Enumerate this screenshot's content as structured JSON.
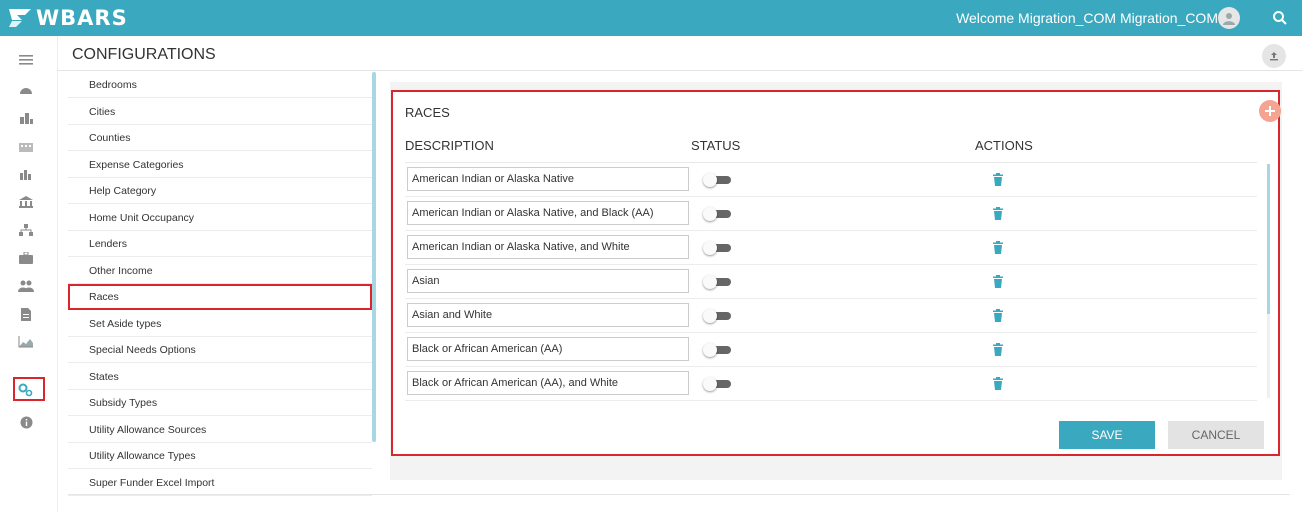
{
  "app": {
    "logo_text": "WBARS",
    "welcome": "Welcome Migration_COM Migration_COM"
  },
  "header": {
    "title": "CONFIGURATIONS"
  },
  "nav_icons": [
    "menu-icon",
    "dashboard-icon",
    "buildings-icon",
    "city-icon",
    "chart-bars-icon",
    "bank-icon",
    "org-icon",
    "briefcase-icon",
    "users-icon",
    "document-icon",
    "area-chart-icon",
    "settings-gears-icon",
    "info-icon"
  ],
  "sidebar": {
    "items": [
      {
        "label": "Bedrooms"
      },
      {
        "label": "Cities"
      },
      {
        "label": "Counties"
      },
      {
        "label": "Expense Categories"
      },
      {
        "label": "Help Category"
      },
      {
        "label": "Home Unit Occupancy"
      },
      {
        "label": "Lenders"
      },
      {
        "label": "Other Income"
      },
      {
        "label": "Races"
      },
      {
        "label": "Set Aside types"
      },
      {
        "label": "Special Needs Options"
      },
      {
        "label": "States"
      },
      {
        "label": "Subsidy Types"
      },
      {
        "label": "Utility Allowance Sources"
      },
      {
        "label": "Utility Allowance Types"
      },
      {
        "label": "Super Funder Excel Import"
      }
    ],
    "selected": "Races"
  },
  "panel": {
    "title": "RACES",
    "columns": {
      "description": "DESCRIPTION",
      "status": "STATUS",
      "actions": "ACTIONS"
    },
    "rows": [
      {
        "description": "American Indian or Alaska Native"
      },
      {
        "description": "American Indian or Alaska Native, and Black (AA)"
      },
      {
        "description": "American Indian or Alaska Native, and White"
      },
      {
        "description": "Asian"
      },
      {
        "description": "Asian and White"
      },
      {
        "description": "Black or African American (AA)"
      },
      {
        "description": "Black or African American (AA), and White"
      }
    ],
    "save_label": "SAVE",
    "cancel_label": "CANCEL"
  },
  "colors": {
    "accent": "#3aa8bf",
    "highlight": "#d9262c",
    "add_button": "#f4a490"
  }
}
